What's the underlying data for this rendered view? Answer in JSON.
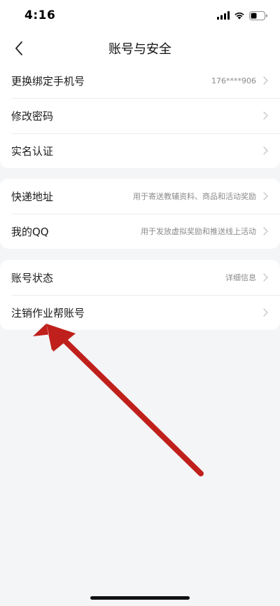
{
  "status_bar": {
    "time": "4:16"
  },
  "nav": {
    "title": "账号与安全"
  },
  "sections": [
    {
      "rows": [
        {
          "label": "更换绑定手机号",
          "value": "176****906"
        },
        {
          "label": "修改密码",
          "value": ""
        },
        {
          "label": "实名认证",
          "value": ""
        }
      ]
    },
    {
      "rows": [
        {
          "label": "快递地址",
          "value": "用于寄送教辅资料、商品和活动奖励"
        },
        {
          "label": "我的QQ",
          "value": "用于发放虚拟奖励和推送线上活动"
        }
      ]
    },
    {
      "rows": [
        {
          "label": "账号状态",
          "value": "详细信息"
        },
        {
          "label": "注销作业帮账号",
          "value": ""
        }
      ]
    }
  ],
  "colors": {
    "annotation_arrow": "#c0201b",
    "background": "#f4f5f7",
    "card": "#ffffff"
  },
  "icons": {
    "back": "chevron-left-icon",
    "row_arrow": "chevron-right-icon",
    "signal": "cellular-signal-icon",
    "wifi": "wifi-icon",
    "battery": "battery-icon"
  }
}
